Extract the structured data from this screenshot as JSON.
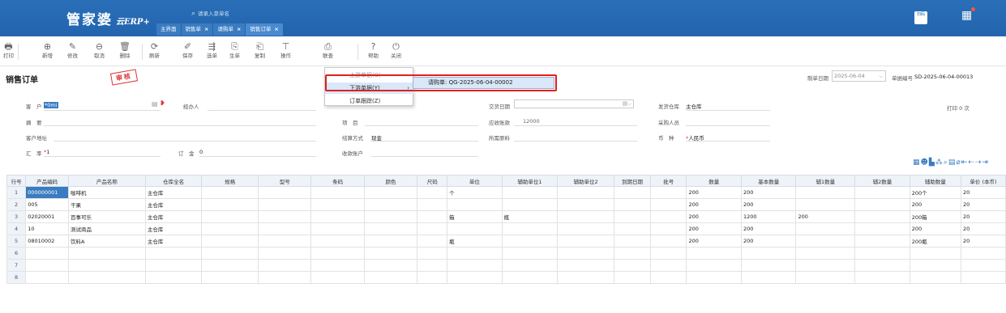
{
  "app": {
    "logo_main": "管家婆",
    "logo_sub": "云ERP+",
    "search_placeholder": "请录入菜单名",
    "tabs": [
      {
        "label": "主界面",
        "closable": false
      },
      {
        "label": "销售单",
        "closable": true
      },
      {
        "label": "请购单",
        "closable": true
      },
      {
        "label": "销售订单",
        "closable": true,
        "active": true
      }
    ],
    "top_right_icon_label": "扫码",
    "close_glyph": "×"
  },
  "toolbar": [
    {
      "icon": "print-icon",
      "glyph": "🖶",
      "label": "打印"
    },
    {
      "icon": "new-icon",
      "glyph": "⊕",
      "label": "新增"
    },
    {
      "icon": "edit-icon",
      "glyph": "✎",
      "label": "修改"
    },
    {
      "icon": "cancel-icon",
      "glyph": "⊖",
      "label": "取消"
    },
    {
      "icon": "delete-icon",
      "glyph": "🗑",
      "label": "删除"
    },
    {
      "icon": "refresh-icon",
      "glyph": "⟳",
      "label": "刷新"
    },
    {
      "icon": "save-icon",
      "glyph": "✐",
      "label": "保存"
    },
    {
      "icon": "select-order-icon",
      "glyph": "⇶",
      "label": "选单"
    },
    {
      "icon": "generate-icon",
      "glyph": "⎘",
      "label": "生单"
    },
    {
      "icon": "copy-icon",
      "glyph": "⎗",
      "label": "复制"
    },
    {
      "icon": "operate-icon",
      "glyph": "⊤",
      "label": "操作"
    },
    {
      "icon": "link-query-icon",
      "glyph": "⎙",
      "label": "联查"
    },
    {
      "icon": "help-icon",
      "glyph": "?",
      "label": "帮助"
    },
    {
      "icon": "power-icon",
      "glyph": "⏻",
      "label": "关闭"
    }
  ],
  "page": {
    "title": "销售订单",
    "stamp": "审核",
    "date_label": "制单日期",
    "date_value": "2025-06-04",
    "number_label": "单据编号",
    "number_value": "SD-2025-06-04-00013",
    "print_count": "打印 0 次"
  },
  "form": {
    "customer_label": "客　户",
    "customer_value": "*0mi",
    "handler_label": "经办人",
    "summary_label": "摘　要",
    "project_label": "项　目",
    "receivable_label": "应收账款",
    "receivable_value": "12000",
    "address_label": "客户地址",
    "settle_label": "结算方式",
    "settle_value": "现金",
    "attach_label": "所需原料",
    "rate_label": "汇　率",
    "rate_value": "1",
    "deposit_label": "订　金",
    "deposit_value": "0",
    "account_label": "收款账户",
    "delivery_label": "交货日期",
    "warehouse_label": "发货仓库",
    "warehouse_value": "主仓库",
    "buyer_label": "采购人员",
    "currency_label": "币　种",
    "currency_value": "人民币"
  },
  "context_menu": {
    "items": [
      {
        "label": "上游单据(O)",
        "has_sub": false
      },
      {
        "label": "下游单据(Y)",
        "has_sub": true,
        "highlighted": true
      },
      {
        "label": "订单跟踪(Z)",
        "has_sub": false
      }
    ],
    "submenu_item": "请购单: QG-2025-06-04-00002"
  },
  "grid_icons": "▦☻▙⁂⌕▤⌀⇤⇠⇢⇥",
  "table": {
    "columns": [
      "行号",
      "产品编码",
      "产品名称",
      "仓库全名",
      "规格",
      "型号",
      "条码",
      "颜色",
      "尺码",
      "单位",
      "辅助单位1",
      "辅助单位2",
      "到期日期",
      "批号",
      "数量",
      "基本数量",
      "辅1数量",
      "辅2数量",
      "辅助数量",
      "单价 (本币)"
    ],
    "rows": [
      [
        "1",
        "000000001",
        "咖啡机",
        "主仓库",
        "",
        "",
        "",
        "",
        "",
        "个",
        "",
        "",
        "",
        "",
        "200",
        "200",
        "",
        "",
        "200个",
        "20"
      ],
      [
        "2",
        "005",
        "干果",
        "主仓库",
        "",
        "",
        "",
        "",
        "",
        "",
        "",
        "",
        "",
        "",
        "200",
        "200",
        "",
        "",
        "200",
        "20"
      ],
      [
        "3",
        "02020001",
        "百事可乐",
        "主仓库",
        "",
        "",
        "",
        "",
        "",
        "箱",
        "瓶",
        "",
        "",
        "",
        "200",
        "1200",
        "200",
        "",
        "200箱",
        "20"
      ],
      [
        "4",
        "10",
        "测试商品",
        "主仓库",
        "",
        "",
        "",
        "",
        "",
        "",
        "",
        "",
        "",
        "",
        "200",
        "200",
        "",
        "",
        "200",
        "20"
      ],
      [
        "5",
        "08010002",
        "饮料A",
        "主仓库",
        "",
        "",
        "",
        "",
        "",
        "瓶",
        "",
        "",
        "",
        "",
        "200",
        "200",
        "",
        "",
        "200瓶",
        "20"
      ],
      [
        "6",
        "",
        "",
        "",
        "",
        "",
        "",
        "",
        "",
        "",
        "",
        "",
        "",
        "",
        "",
        "",
        "",
        "",
        "",
        ""
      ],
      [
        "7",
        "",
        "",
        "",
        "",
        "",
        "",
        "",
        "",
        "",
        "",
        "",
        "",
        "",
        "",
        "",
        "",
        "",
        "",
        ""
      ],
      [
        "8",
        "",
        "",
        "",
        "",
        "",
        "",
        "",
        "",
        "",
        "",
        "",
        "",
        "",
        "",
        "",
        "",
        "",
        "",
        ""
      ]
    ]
  }
}
